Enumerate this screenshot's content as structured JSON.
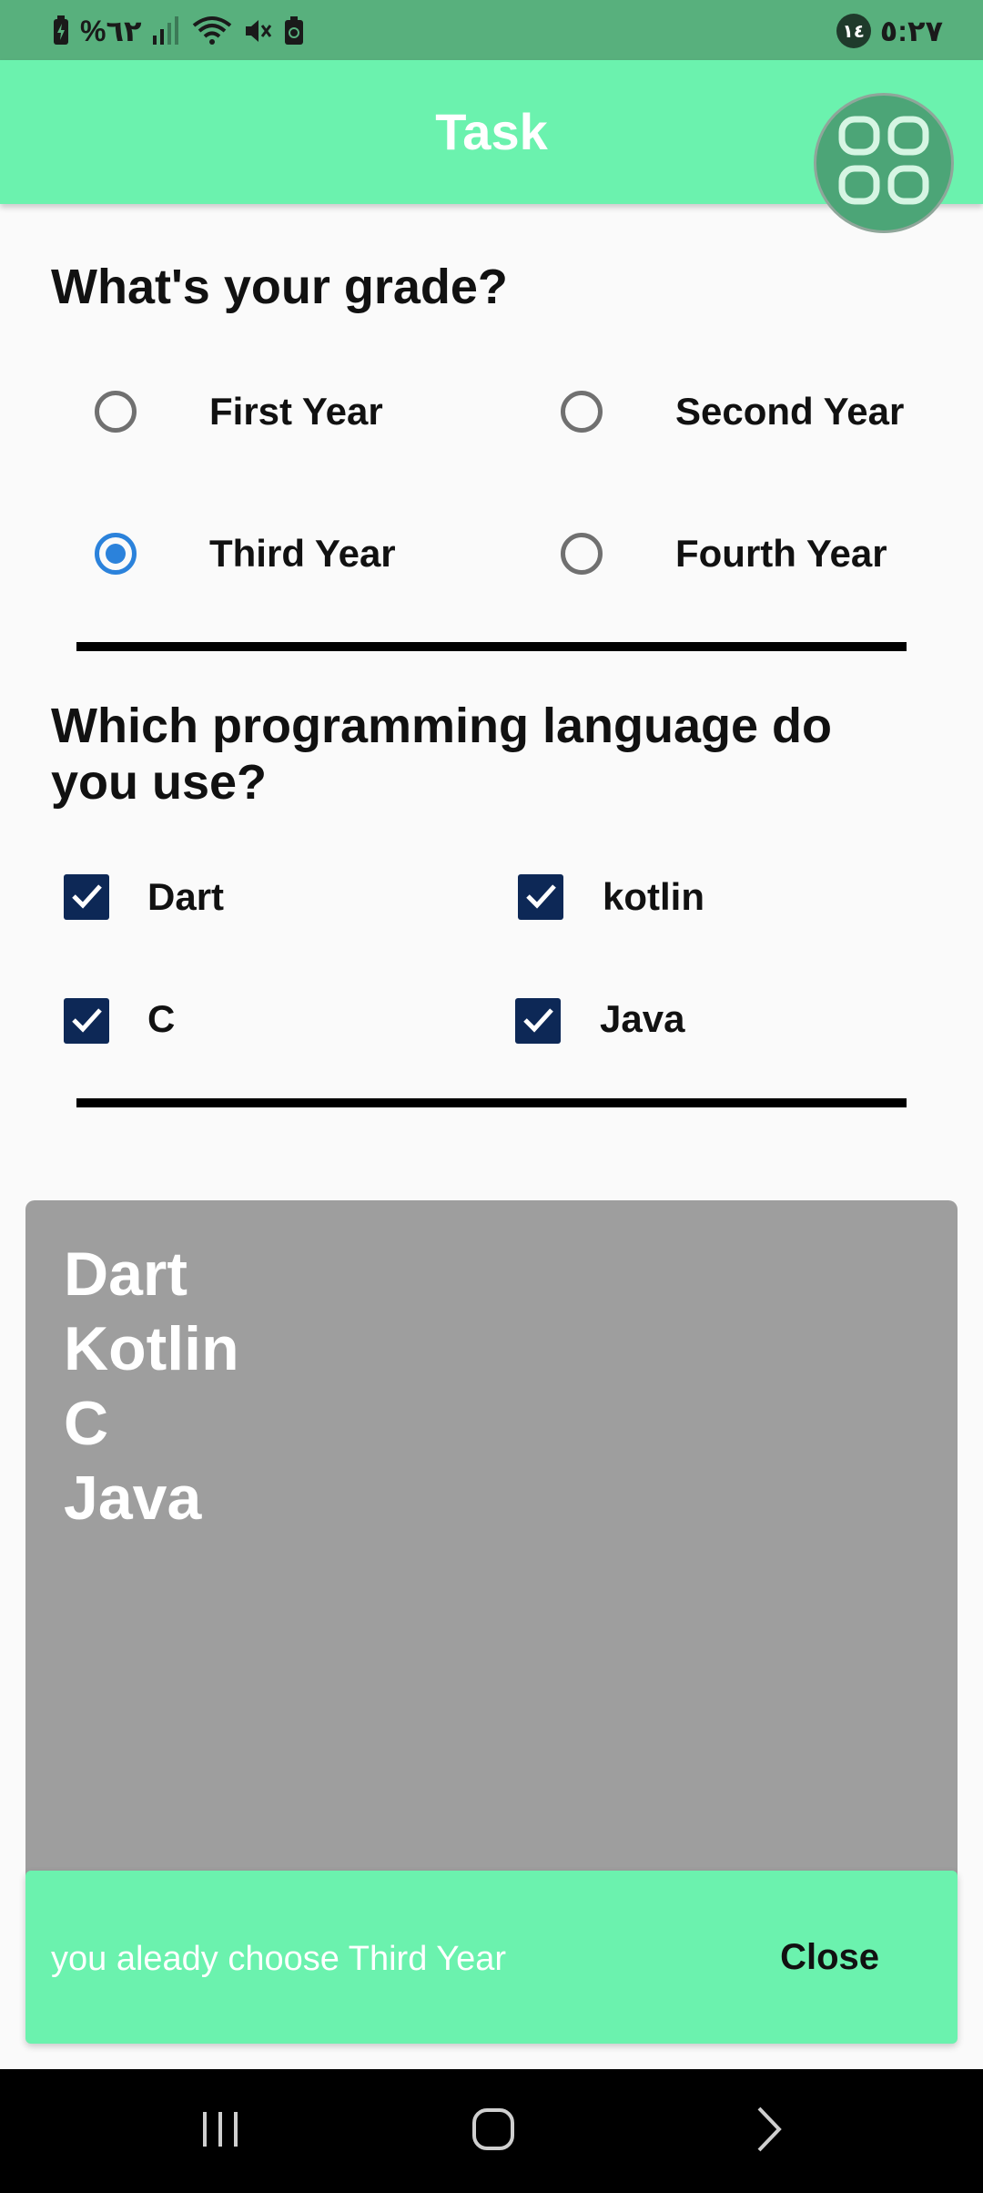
{
  "status_bar": {
    "left_text": "%٦٢",
    "time": "٥:٢٧",
    "notification_count": "١٤"
  },
  "app_bar": {
    "title": "Task",
    "fab_icon": "grid-view-icon"
  },
  "grade_section": {
    "question": "What's your grade?",
    "options": [
      {
        "label": "First Year",
        "selected": false
      },
      {
        "label": "Second Year",
        "selected": false
      },
      {
        "label": "Third Year",
        "selected": true
      },
      {
        "label": "Fourth Year",
        "selected": false
      }
    ]
  },
  "language_section": {
    "question": "Which programming language do you use?",
    "options": [
      {
        "label": "Dart",
        "checked": true
      },
      {
        "label": "kotlin",
        "checked": true
      },
      {
        "label": "C",
        "checked": true
      },
      {
        "label": "Java",
        "checked": true
      }
    ]
  },
  "result_panel": {
    "lines": [
      "Dart",
      "Kotlin",
      "C",
      "Java"
    ]
  },
  "snackbar": {
    "message": "you aleady choose Third Year",
    "action_label": "Close"
  },
  "colors": {
    "status_bar": "#58b07d",
    "app_bar": "#6bf2ae",
    "radio_selected": "#2b82db",
    "checkbox": "#0d2856",
    "result_panel": "#9e9e9e"
  }
}
